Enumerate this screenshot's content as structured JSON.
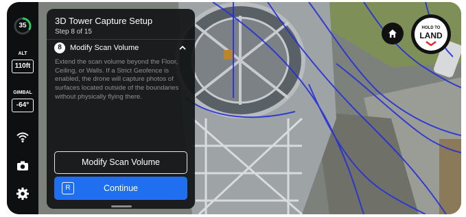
{
  "rail": {
    "battery": "35",
    "alt_label": "ALT",
    "alt_value": "110ft",
    "gimbal_label": "GIMBAL",
    "gimbal_value": "-64°"
  },
  "panel": {
    "title": "3D Tower Capture Setup",
    "step": "Step 8 of 15",
    "step_number": "8",
    "step_title": "Modify Scan Volume",
    "description": "Extend the scan volume beyond the Floor, Ceiling, or Walls. If a Strict Geofence is enabled, the drone will capture photos of surfaces located outside of the boundaries without physically flying there.",
    "secondary_button": "Modify Scan Volume",
    "primary_button": "Continue",
    "primary_key": "R"
  },
  "controls": {
    "land_small": "HOLD TO",
    "land_big": "LAND"
  },
  "colors": {
    "accent": "#1f6ff0",
    "battery_ring": "#2ecc5a",
    "flight_path": "#2530d8",
    "land_arrow": "#e0262b"
  },
  "icons": [
    "wifi-icon",
    "camera-icon",
    "gear-icon",
    "home-icon",
    "chevron-up-icon"
  ]
}
